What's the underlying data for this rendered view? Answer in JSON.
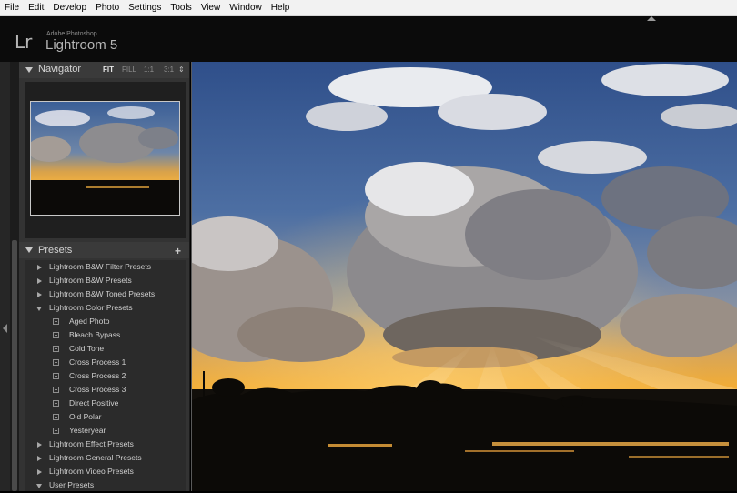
{
  "menu": [
    "File",
    "Edit",
    "Develop",
    "Photo",
    "Settings",
    "Tools",
    "View",
    "Window",
    "Help"
  ],
  "identity": {
    "logo": "Lr",
    "brand_small": "Adobe Photoshop",
    "brand_big": "Lightroom 5"
  },
  "navigator": {
    "title": "Navigator",
    "zoom_options": [
      "FIT",
      "FILL",
      "1:1",
      "3:1"
    ],
    "selected_zoom": "FIT"
  },
  "presets": {
    "title": "Presets",
    "add_label": "+",
    "items": [
      {
        "label": "Lightroom B&W Filter Presets",
        "type": "folder",
        "expanded": false
      },
      {
        "label": "Lightroom B&W Presets",
        "type": "folder",
        "expanded": false
      },
      {
        "label": "Lightroom B&W Toned Presets",
        "type": "folder",
        "expanded": false
      },
      {
        "label": "Lightroom Color Presets",
        "type": "folder",
        "expanded": true
      },
      {
        "label": "Aged Photo",
        "type": "preset"
      },
      {
        "label": "Bleach Bypass",
        "type": "preset"
      },
      {
        "label": "Cold Tone",
        "type": "preset"
      },
      {
        "label": "Cross Process 1",
        "type": "preset"
      },
      {
        "label": "Cross Process 2",
        "type": "preset"
      },
      {
        "label": "Cross Process 3",
        "type": "preset"
      },
      {
        "label": "Direct Positive",
        "type": "preset"
      },
      {
        "label": "Old Polar",
        "type": "preset"
      },
      {
        "label": "Yesteryear",
        "type": "preset"
      },
      {
        "label": "Lightroom Effect Presets",
        "type": "folder",
        "expanded": false
      },
      {
        "label": "Lightroom General Presets",
        "type": "folder",
        "expanded": false
      },
      {
        "label": "Lightroom Video Presets",
        "type": "folder",
        "expanded": false
      },
      {
        "label": "User Presets",
        "type": "folder",
        "expanded": true
      }
    ]
  },
  "colors": {
    "panel": "#333333",
    "sky": "#3f6aa8",
    "sunset": "#f0a030"
  }
}
